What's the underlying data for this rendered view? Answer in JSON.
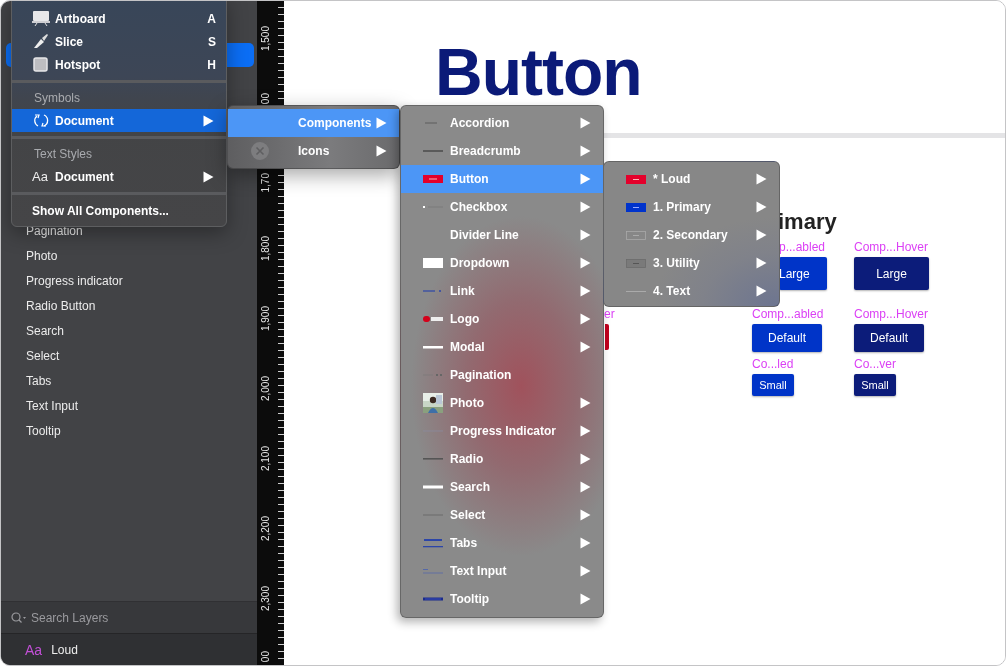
{
  "sidebar": {
    "selection_visible": true,
    "layers": [
      {
        "label": "Pagination"
      },
      {
        "label": "Photo"
      },
      {
        "label": "Progress indicator"
      },
      {
        "label": "Radio Button"
      },
      {
        "label": "Search"
      },
      {
        "label": "Select"
      },
      {
        "label": "Tabs"
      },
      {
        "label": "Text Input"
      },
      {
        "label": "Tooltip"
      }
    ],
    "search": {
      "placeholder": "Search Layers"
    },
    "footer": {
      "prefix": "Aa",
      "label": "Loud"
    }
  },
  "ruler": {
    "labels": [
      {
        "text": "1,500"
      },
      {
        "text": "00"
      },
      {
        "text": "1,70"
      },
      {
        "text": "1,800"
      },
      {
        "text": "1,900"
      },
      {
        "text": "2,000"
      },
      {
        "text": "2,100"
      },
      {
        "text": "2,200"
      },
      {
        "text": "2,300"
      },
      {
        "text": "00"
      }
    ]
  },
  "canvas": {
    "title": "Button",
    "heading": "imary",
    "columns": [
      {
        "cells": [
          null,
          {
            "kind": "covered",
            "label": "er"
          },
          null
        ]
      },
      {
        "cells": [
          {
            "kind": "button",
            "label": "p...abled",
            "button": "Large"
          },
          {
            "kind": "button",
            "label": "Comp...abled",
            "button": "Default"
          },
          {
            "kind": "button",
            "label": "Co...led",
            "button": "Small"
          }
        ]
      },
      {
        "cells": [
          {
            "kind": "button",
            "label": "Comp...Hover",
            "button": "Large"
          },
          {
            "kind": "button",
            "label": "Comp...Hover",
            "button": "Default"
          },
          {
            "kind": "button",
            "label": "Co...ver",
            "button": "Small"
          }
        ]
      }
    ]
  },
  "insert_menu": {
    "items": [
      {
        "kind": "item",
        "label": "Artboard",
        "shortcut": "A",
        "selected": false,
        "submenu": false
      },
      {
        "kind": "item",
        "label": "Slice",
        "shortcut": "S",
        "selected": false,
        "submenu": false
      },
      {
        "kind": "item",
        "label": "Hotspot",
        "shortcut": "H",
        "selected": false,
        "submenu": false
      },
      {
        "kind": "separator"
      },
      {
        "kind": "header",
        "label": "Symbols"
      },
      {
        "kind": "item",
        "label": "Document",
        "selected": true,
        "submenu": true
      },
      {
        "kind": "separator"
      },
      {
        "kind": "header",
        "label": "Text Styles"
      },
      {
        "kind": "item",
        "prefix": "Aa",
        "label": "Document",
        "selected": false,
        "submenu": true
      },
      {
        "kind": "separator"
      },
      {
        "kind": "action",
        "label": "Show All Components...",
        "selected": false,
        "submenu": false
      }
    ]
  },
  "library_menu": {
    "items": [
      {
        "label": "Components",
        "selected": true,
        "submenu": true
      },
      {
        "label": "Icons",
        "selected": false,
        "submenu": true
      }
    ]
  },
  "components_menu": {
    "items": [
      {
        "label": "Accordion",
        "selected": false,
        "submenu": true
      },
      {
        "label": "Breadcrumb",
        "selected": false,
        "submenu": true
      },
      {
        "label": "Button",
        "selected": true,
        "submenu": true
      },
      {
        "label": "Checkbox",
        "selected": false,
        "submenu": true
      },
      {
        "label": "Divider Line",
        "selected": false,
        "submenu": true
      },
      {
        "label": "Dropdown",
        "selected": false,
        "submenu": true
      },
      {
        "label": "Link",
        "selected": false,
        "submenu": true
      },
      {
        "label": "Logo",
        "selected": false,
        "submenu": true
      },
      {
        "label": "Modal",
        "selected": false,
        "submenu": true
      },
      {
        "label": "Pagination",
        "selected": false,
        "submenu": false
      },
      {
        "label": "Photo",
        "selected": false,
        "submenu": true
      },
      {
        "label": "Progress Indicator",
        "selected": false,
        "submenu": true
      },
      {
        "label": "Radio",
        "selected": false,
        "submenu": true
      },
      {
        "label": "Search",
        "selected": false,
        "submenu": true
      },
      {
        "label": "Select",
        "selected": false,
        "submenu": true
      },
      {
        "label": "Tabs",
        "selected": false,
        "submenu": true
      },
      {
        "label": "Text Input",
        "selected": false,
        "submenu": true
      },
      {
        "label": "Tooltip",
        "selected": false,
        "submenu": true
      }
    ]
  },
  "button_menu": {
    "items": [
      {
        "label": "* Loud",
        "selected": false,
        "submenu": true
      },
      {
        "label": "1. Primary",
        "selected": false,
        "submenu": true
      },
      {
        "label": "2. Secondary",
        "selected": false,
        "submenu": true
      },
      {
        "label": "3. Utility",
        "selected": false,
        "submenu": true
      },
      {
        "label": "4. Text",
        "selected": false,
        "submenu": true
      }
    ]
  }
}
